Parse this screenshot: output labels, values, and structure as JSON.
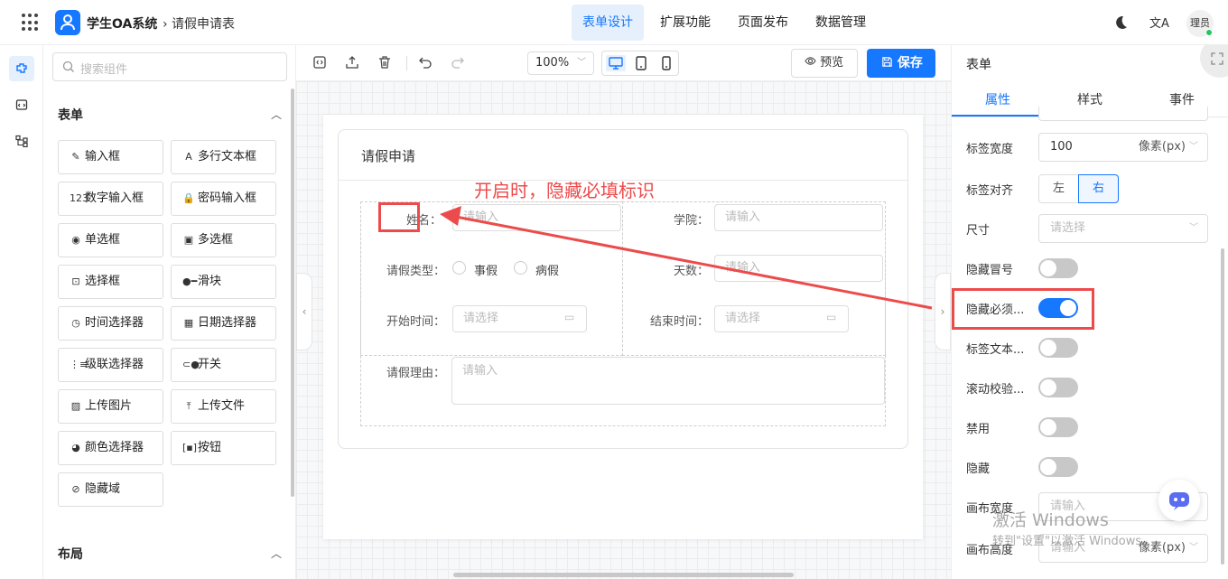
{
  "app": {
    "title": "学生OA系统",
    "breadcrumb": "› 请假申请表"
  },
  "nav": [
    {
      "label": "表单设计",
      "active": true
    },
    {
      "label": "扩展功能",
      "active": false
    },
    {
      "label": "页面发布",
      "active": false
    },
    {
      "label": "数据管理",
      "active": false
    }
  ],
  "header": {
    "lang_icon": "文A",
    "avatar_text": "理员"
  },
  "palette": {
    "search_placeholder": "搜索组件",
    "section_form": "表单",
    "section_layout": "布局",
    "components": [
      {
        "label": "输入框",
        "icon": "edit-icon",
        "glyph": "✎"
      },
      {
        "label": "多行文本框",
        "icon": "textarea-icon",
        "glyph": "A"
      },
      {
        "label": "数字输入框",
        "icon": "number-icon",
        "glyph": "123"
      },
      {
        "label": "密码输入框",
        "icon": "lock-icon",
        "glyph": "🔒"
      },
      {
        "label": "单选框",
        "icon": "radio-icon",
        "glyph": "◉"
      },
      {
        "label": "多选框",
        "icon": "checkbox-icon",
        "glyph": "▣"
      },
      {
        "label": "选择框",
        "icon": "select-icon",
        "glyph": "⊡"
      },
      {
        "label": "滑块",
        "icon": "slider-icon",
        "glyph": "●━"
      },
      {
        "label": "时间选择器",
        "icon": "clock-icon",
        "glyph": "◷"
      },
      {
        "label": "日期选择器",
        "icon": "calendar-icon",
        "glyph": "▦"
      },
      {
        "label": "级联选择器",
        "icon": "cascader-icon",
        "glyph": "⋮≡"
      },
      {
        "label": "开关",
        "icon": "switch-icon",
        "glyph": "⊂●"
      },
      {
        "label": "上传图片",
        "icon": "image-icon",
        "glyph": "▨"
      },
      {
        "label": "上传文件",
        "icon": "upload-icon",
        "glyph": "⤒"
      },
      {
        "label": "颜色选择器",
        "icon": "palette-icon",
        "glyph": "◕"
      },
      {
        "label": "按钮",
        "icon": "button-icon",
        "glyph": "[▪]"
      },
      {
        "label": "隐藏域",
        "icon": "eye-off-icon",
        "glyph": "⊘"
      }
    ]
  },
  "toolbar": {
    "zoom": "100%",
    "preview_label": "预览",
    "save_label": "保存"
  },
  "form": {
    "title": "请假申请",
    "fields": {
      "name_label": "姓名：",
      "name_placeholder": "请输入",
      "college_label": "学院：",
      "college_placeholder": "请输入",
      "type_label": "请假类型：",
      "type_options": [
        "事假",
        "病假"
      ],
      "days_label": "天数：",
      "days_placeholder": "请输入",
      "start_label": "开始时间：",
      "start_placeholder": "请选择",
      "end_label": "结束时间：",
      "end_placeholder": "请选择",
      "reason_label": "请假理由：",
      "reason_placeholder": "请输入"
    }
  },
  "props": {
    "panel_title": "表单",
    "tabs": [
      "属性",
      "样式",
      "事件"
    ],
    "active_tab": "属性",
    "label_width_label": "标签宽度",
    "label_width_value": "100",
    "label_width_unit": "像素(px)",
    "label_align_label": "标签对齐",
    "align_left": "左",
    "align_right": "右",
    "size_label": "尺寸",
    "size_placeholder": "请选择",
    "toggles": [
      {
        "label": "隐藏冒号",
        "on": false
      },
      {
        "label": "隐藏必须...",
        "on": true
      },
      {
        "label": "标签文本...",
        "on": false
      },
      {
        "label": "滚动校验...",
        "on": false
      },
      {
        "label": "禁用",
        "on": false
      },
      {
        "label": "隐藏",
        "on": false
      }
    ],
    "canvas_width_label": "画布宽度",
    "canvas_width_placeholder": "请输入",
    "canvas_width_unit": "像素",
    "canvas_height_label": "画布高度",
    "canvas_height_placeholder": "请输入",
    "canvas_height_unit": "像素(px)"
  },
  "annotation": {
    "text": "开启时，隐藏必填标识"
  },
  "watermark": {
    "line1": "激活 Windows",
    "line2": "转到\"设置\"以激活 Windows。"
  },
  "colors": {
    "accent": "#1677ff",
    "annotation": "#ec4b4b"
  }
}
